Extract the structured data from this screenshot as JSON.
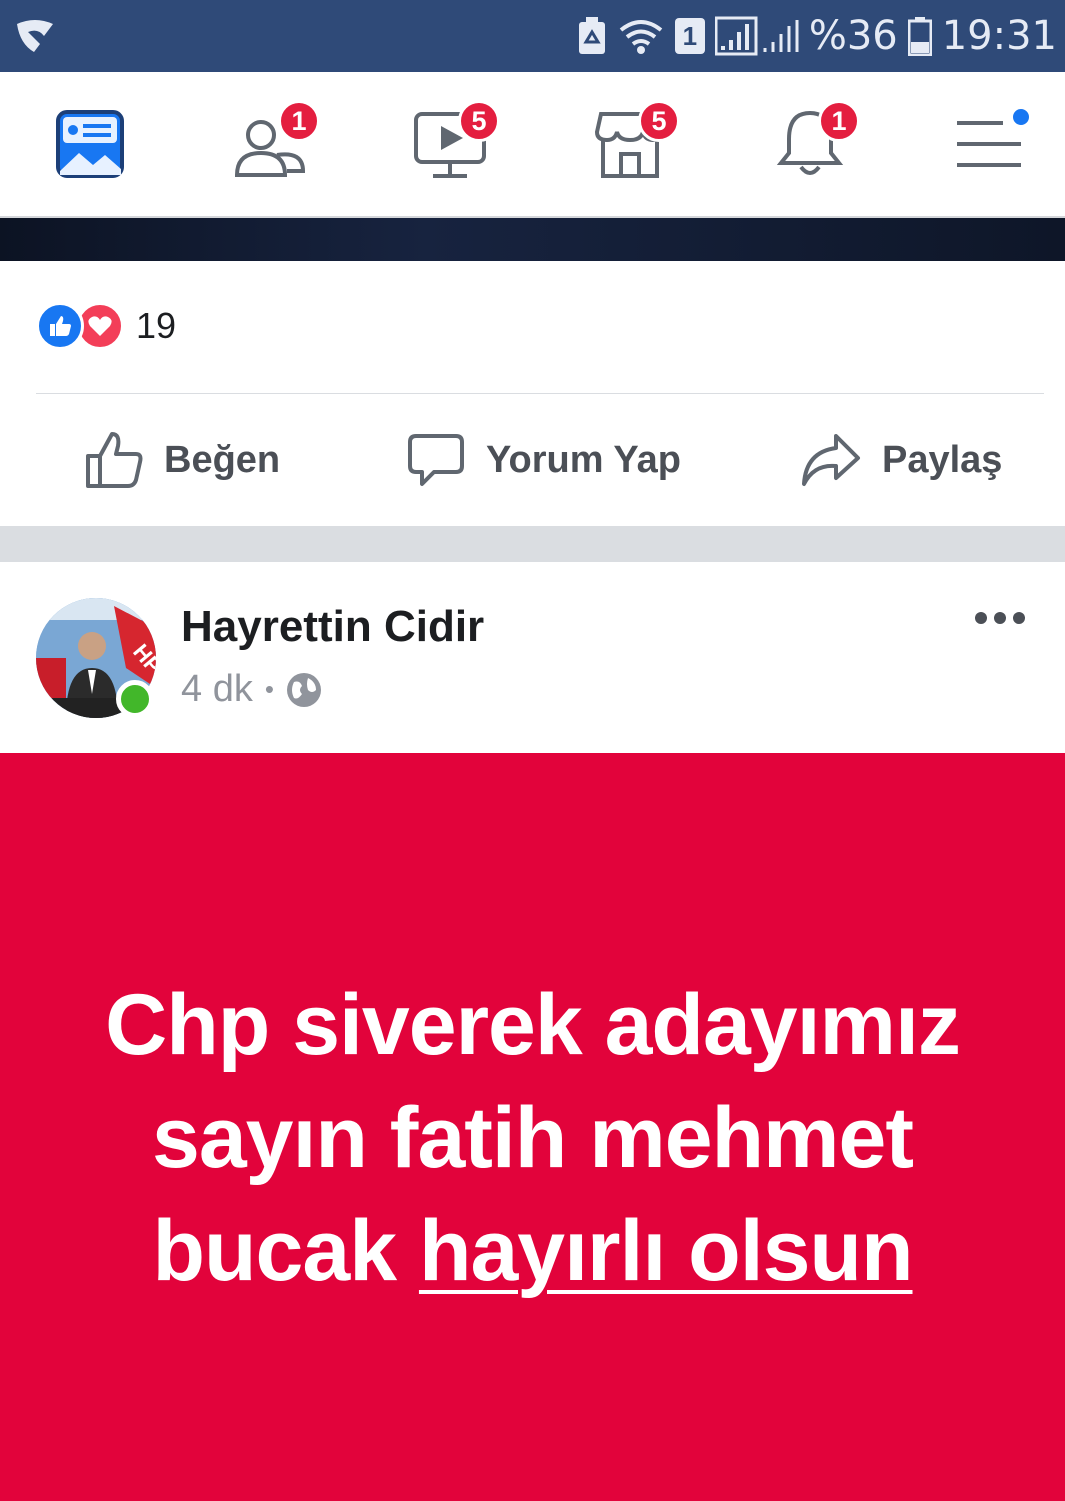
{
  "status_bar": {
    "sim_badge": "1",
    "battery_percent": "%36",
    "time": "19:31"
  },
  "nav": {
    "friends_badge": "1",
    "watch_badge": "5",
    "marketplace_badge": "5",
    "notifications_badge": "1"
  },
  "reactions": {
    "count": "19"
  },
  "actions": {
    "like_label": "Beğen",
    "comment_label": "Yorum Yap",
    "share_label": "Paylaş"
  },
  "post": {
    "author": "Hayrettin Cidir",
    "time": "4 dk",
    "separator": "•",
    "text_main": "Chp siverek adayımız sayın fatih mehmet bucak ",
    "text_highlight": "hayırlı olsun",
    "background_color": "#e2033b"
  },
  "colors": {
    "status_bar": "#2f4a78",
    "accent": "#1877f2",
    "badge": "#e41e3f",
    "online": "#42b72a"
  },
  "icons": [
    "app-logo-icon",
    "recycle-icon",
    "wifi-icon",
    "sim-icon",
    "signal-icon",
    "battery-icon",
    "news-feed-icon",
    "friends-icon",
    "watch-icon",
    "marketplace-icon",
    "notifications-icon",
    "menu-icon",
    "like-reaction-icon",
    "love-reaction-icon",
    "like-icon",
    "comment-icon",
    "share-icon",
    "globe-icon",
    "more-options-icon"
  ]
}
